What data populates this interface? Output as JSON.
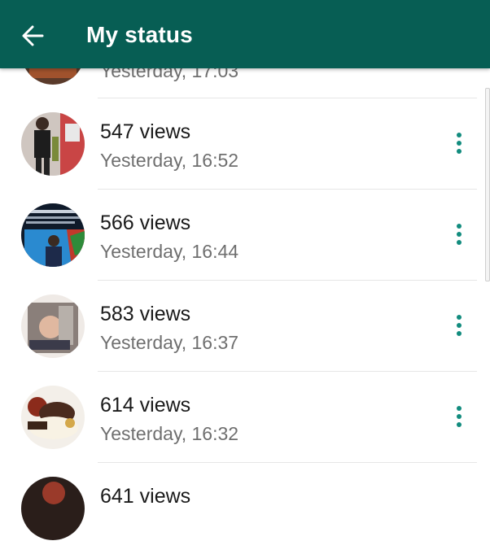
{
  "app_bar": {
    "title": "My status",
    "back_icon": "arrow-left-icon",
    "background": "#075E54"
  },
  "accent_color": "#128C7E",
  "statuses": [
    {
      "views": "",
      "time": "Yesterday, 17:03"
    },
    {
      "views": "547 views",
      "time": "Yesterday, 16:52"
    },
    {
      "views": "566 views",
      "time": "Yesterday, 16:44"
    },
    {
      "views": "583 views",
      "time": "Yesterday, 16:37"
    },
    {
      "views": "614 views",
      "time": "Yesterday, 16:32"
    },
    {
      "views": "641 views",
      "time": ""
    }
  ],
  "row_menu_icon": "more-vertical-icon"
}
